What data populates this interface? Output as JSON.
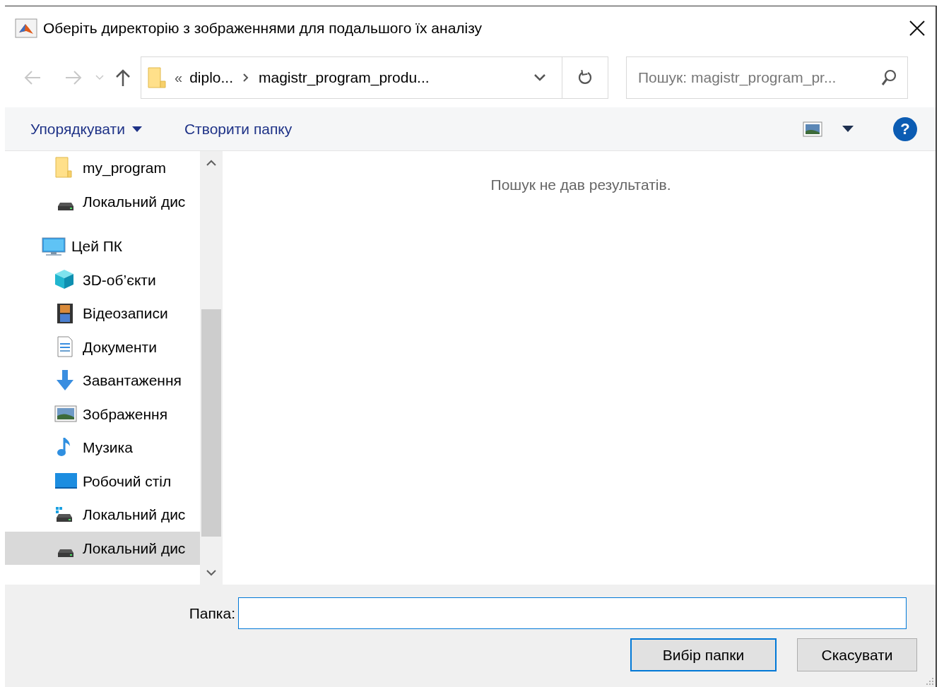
{
  "window": {
    "title": "Оберіть директорію з зображеннями для подальшого їх аналізу"
  },
  "address_bar": {
    "overflow": "«",
    "segments": [
      "diplo...",
      "magistr_program_produ..."
    ]
  },
  "search": {
    "placeholder": "Пошук: magistr_program_pr..."
  },
  "toolbar": {
    "organize": "Упорядкувати",
    "new_folder": "Створити папку",
    "help": "?"
  },
  "tree": [
    {
      "children": [
        {
          "kind": "folder",
          "label": "my_program",
          "selected": false
        },
        {
          "kind": "drive",
          "label": "Локальний дис",
          "selected": false
        }
      ]
    },
    {
      "kind": "pc",
      "label": "Цей ПК",
      "selected": false,
      "children": [
        {
          "kind": "cube",
          "label": "3D-об’єкти",
          "selected": false
        },
        {
          "kind": "video",
          "label": "Відеозаписи",
          "selected": false
        },
        {
          "kind": "docs",
          "label": "Документи",
          "selected": false
        },
        {
          "kind": "download",
          "label": "Завантаження",
          "selected": false
        },
        {
          "kind": "pictures",
          "label": "Зображення",
          "selected": false
        },
        {
          "kind": "music",
          "label": "Музика",
          "selected": false
        },
        {
          "kind": "desktop",
          "label": "Робочий стіл",
          "selected": false
        },
        {
          "kind": "windrive",
          "label": "Локальний дис",
          "selected": false
        },
        {
          "kind": "drive",
          "label": "Локальний дис",
          "selected": true
        }
      ]
    }
  ],
  "content": {
    "message": "Пошук не дав результатів."
  },
  "folder_field": {
    "label": "Папка:"
  },
  "buttons": [
    {
      "label": "Вибір папки",
      "default": true
    },
    {
      "label": "Скасувати",
      "default": false
    }
  ]
}
